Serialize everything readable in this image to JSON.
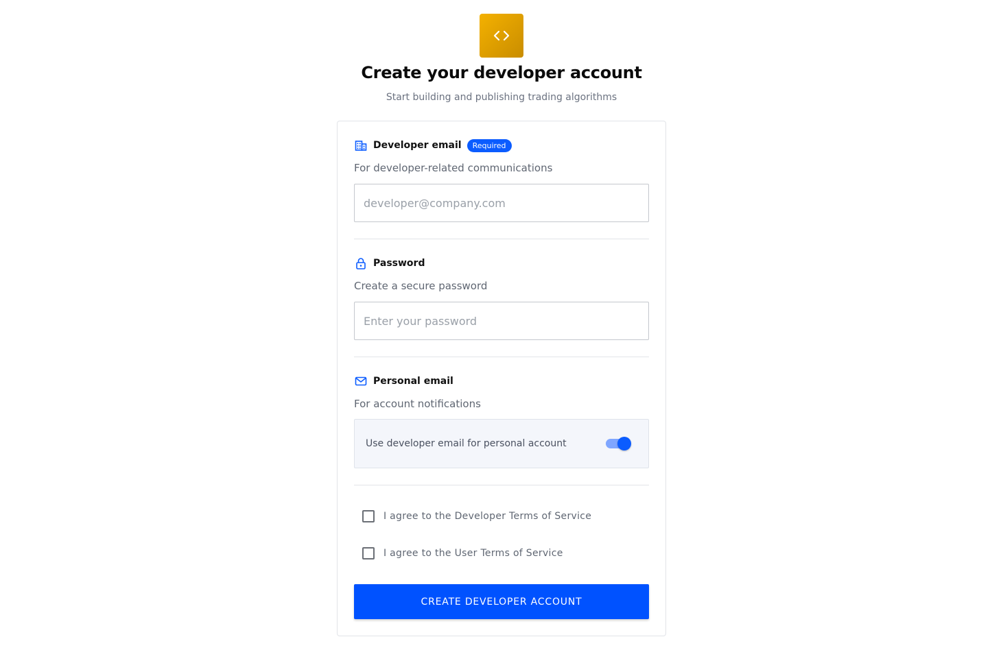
{
  "header": {
    "logo_icon": "code-brackets-icon",
    "title": "Create your developer account",
    "subtitle": "Start building and publishing trading algorithms"
  },
  "form": {
    "developer_email": {
      "icon": "building-icon",
      "label": "Developer email",
      "badge": "Required",
      "helper": "For developer-related communications",
      "value": "",
      "placeholder": "developer@company.com"
    },
    "password": {
      "icon": "lock-icon",
      "label": "Password",
      "helper": "Create a secure password",
      "value": "",
      "placeholder": "Enter your password"
    },
    "personal_email": {
      "icon": "mail-icon",
      "label": "Personal email",
      "helper": "For account notifications",
      "toggle_label": "Use developer email for personal account",
      "toggle_on": true
    },
    "agreements": [
      {
        "label": "I agree to the Developer Terms of Service",
        "checked": false
      },
      {
        "label": "I agree to the User Terms of Service",
        "checked": false
      }
    ],
    "submit_label": "CREATE DEVELOPER ACCOUNT"
  },
  "colors": {
    "accent": "#0052ff",
    "badge": "#0b5cff",
    "logo_start": "#f4b100",
    "logo_end": "#c98d00"
  }
}
